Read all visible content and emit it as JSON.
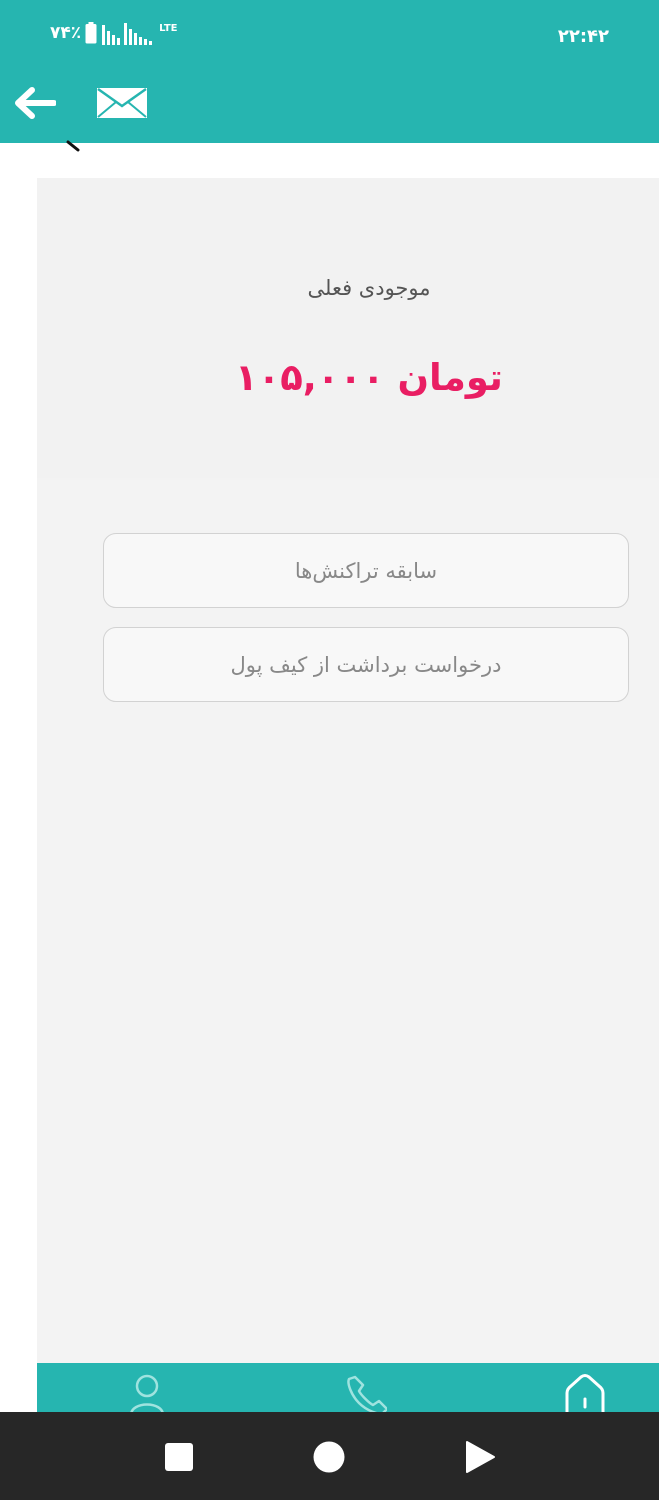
{
  "status_bar": {
    "battery_percent": "۷۴٪",
    "network": "LTE",
    "time": "۲۲:۴۲"
  },
  "header": {
    "back_icon": "arrow-left-icon",
    "mail_icon": "envelope-icon"
  },
  "wallet": {
    "balance_label": "موجودی فعلی",
    "balance_amount": "۱۰۵,۰۰۰ تومان"
  },
  "actions": {
    "history_label": "سابقه تراکنش‌ها",
    "withdraw_label": "درخواست برداشت از کیف پول"
  },
  "bottom_nav": {
    "items": [
      "profile-icon",
      "phone-icon",
      "home-icon"
    ]
  },
  "system_nav": {
    "items": [
      "recents-square-icon",
      "home-circle-icon",
      "back-triangle-icon"
    ]
  },
  "colors": {
    "primary": "#26b5b0",
    "amount": "#e91e63",
    "panel": "#f3f3f3",
    "system_nav": "#272727"
  }
}
